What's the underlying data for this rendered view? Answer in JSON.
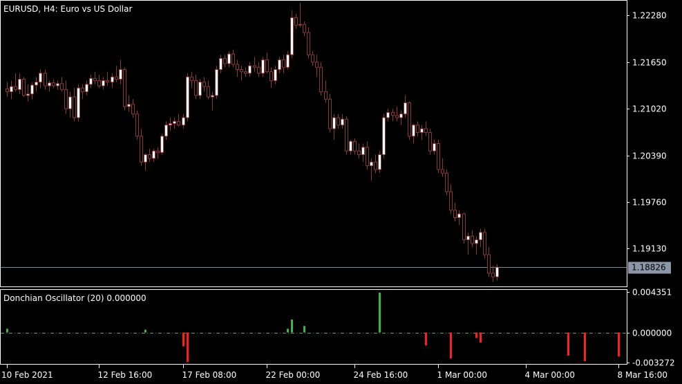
{
  "chart_title": "EURUSD, H4:  Euro vs US Dollar",
  "indicator_title": "Donchian Oscillator (20) 0.000000",
  "current_price": "1.18826",
  "colors": {
    "background": "#000000",
    "axis": "#ffffff",
    "bull_fill": "#ffffff",
    "bear_fill": "#000000",
    "candle_outline": "#8b3a3a",
    "osc_up": "#3cb93c",
    "osc_down": "#ff1e1e",
    "price_line": "#7f8a9a",
    "price_tag_bg": "#8b97a6",
    "zero_line": "#6a8f6a"
  },
  "chart_data": {
    "type": "candlestick",
    "instrument": "EURUSD",
    "timeframe": "H4",
    "price_axis": {
      "ticks": [
        "1.22280",
        "1.21650",
        "1.21020",
        "1.20390",
        "1.19760",
        "1.19130"
      ],
      "tick_values": [
        1.2228,
        1.2165,
        1.2102,
        1.2039,
        1.1976,
        1.1913
      ],
      "range": [
        1.1862,
        1.2248
      ]
    },
    "time_axis": {
      "labels": [
        "10 Feb 2021",
        "12 Feb 16:00",
        "17 Feb 08:00",
        "22 Feb 00:00",
        "24 Feb 16:00",
        "1 Mar 00:00",
        "4 Mar 00:00",
        "8 Mar 16:00"
      ],
      "label_bars": [
        0,
        22,
        42,
        62,
        83,
        103,
        124,
        146
      ]
    },
    "candles": [
      [
        1.2129,
        1.2138,
        1.2118,
        1.2125
      ],
      [
        1.2125,
        1.214,
        1.2115,
        1.2132
      ],
      [
        1.2132,
        1.215,
        1.2125,
        1.2128
      ],
      [
        1.2128,
        1.215,
        1.2122,
        1.2142
      ],
      [
        1.2142,
        1.2145,
        1.2118,
        1.212
      ],
      [
        1.212,
        1.2135,
        1.2112,
        1.2122
      ],
      [
        1.2122,
        1.2138,
        1.2115,
        1.2134
      ],
      [
        1.2134,
        1.2145,
        1.2125,
        1.2138
      ],
      [
        1.2138,
        1.2155,
        1.213,
        1.215
      ],
      [
        1.215,
        1.2155,
        1.2128,
        1.2133
      ],
      [
        1.2133,
        1.214,
        1.2125,
        1.2137
      ],
      [
        1.2137,
        1.2142,
        1.213,
        1.2133
      ],
      [
        1.2133,
        1.214,
        1.2128,
        1.2136
      ],
      [
        1.2136,
        1.2145,
        1.2125,
        1.2128
      ],
      [
        1.2128,
        1.214,
        1.2095,
        1.2102
      ],
      [
        1.2102,
        1.2125,
        1.209,
        1.2118
      ],
      [
        1.2118,
        1.213,
        1.2085,
        1.209
      ],
      [
        1.209,
        1.2135,
        1.2085,
        1.213
      ],
      [
        1.213,
        1.2135,
        1.2115,
        1.2125
      ],
      [
        1.2125,
        1.214,
        1.212,
        1.2135
      ],
      [
        1.2135,
        1.2148,
        1.213,
        1.2143
      ],
      [
        1.2143,
        1.2152,
        1.2135,
        1.214
      ],
      [
        1.214,
        1.2148,
        1.213,
        1.2133
      ],
      [
        1.2133,
        1.2145,
        1.2128,
        1.214
      ],
      [
        1.214,
        1.2152,
        1.2133,
        1.2138
      ],
      [
        1.2138,
        1.215,
        1.213,
        1.2145
      ],
      [
        1.2145,
        1.216,
        1.2138,
        1.2142
      ],
      [
        1.2142,
        1.2168,
        1.2135,
        1.2155
      ],
      [
        1.2155,
        1.2158,
        1.21,
        1.2105
      ],
      [
        1.2105,
        1.212,
        1.2098,
        1.2108
      ],
      [
        1.2108,
        1.2115,
        1.209,
        1.2095
      ],
      [
        1.2095,
        1.21,
        1.206,
        1.2065
      ],
      [
        1.2065,
        1.2075,
        1.2025,
        1.203
      ],
      [
        1.203,
        1.2042,
        1.2018,
        1.204
      ],
      [
        1.204,
        1.2048,
        1.203,
        1.2035
      ],
      [
        1.2035,
        1.2048,
        1.203,
        1.2045
      ],
      [
        1.2045,
        1.205,
        1.2035,
        1.2043
      ],
      [
        1.2043,
        1.2068,
        1.204,
        1.2065
      ],
      [
        1.2065,
        1.2085,
        1.206,
        1.208
      ],
      [
        1.208,
        1.209,
        1.2072,
        1.2082
      ],
      [
        1.2082,
        1.209,
        1.2075,
        1.2085
      ],
      [
        1.2085,
        1.2095,
        1.2078,
        1.208
      ],
      [
        1.208,
        1.2095,
        1.2075,
        1.209
      ],
      [
        1.209,
        1.215,
        1.2085,
        1.2145
      ],
      [
        1.2145,
        1.2152,
        1.213,
        1.214
      ],
      [
        1.214,
        1.2148,
        1.2115,
        1.212
      ],
      [
        1.212,
        1.2142,
        1.2115,
        1.2138
      ],
      [
        1.2138,
        1.2145,
        1.2125,
        1.2132
      ],
      [
        1.2132,
        1.214,
        1.2115,
        1.2118
      ],
      [
        1.2118,
        1.2125,
        1.21,
        1.212
      ],
      [
        1.212,
        1.216,
        1.2115,
        1.2155
      ],
      [
        1.2155,
        1.2175,
        1.215,
        1.217
      ],
      [
        1.217,
        1.2175,
        1.2158,
        1.2163
      ],
      [
        1.2163,
        1.218,
        1.2158,
        1.2176
      ],
      [
        1.2176,
        1.2182,
        1.2158,
        1.2162
      ],
      [
        1.2162,
        1.2168,
        1.2145,
        1.2155
      ],
      [
        1.2155,
        1.216,
        1.214,
        1.2152
      ],
      [
        1.2152,
        1.2158,
        1.2145,
        1.215
      ],
      [
        1.215,
        1.2165,
        1.2145,
        1.216
      ],
      [
        1.216,
        1.2172,
        1.2152,
        1.2158
      ],
      [
        1.2158,
        1.2165,
        1.2145,
        1.215
      ],
      [
        1.215,
        1.2172,
        1.2145,
        1.2168
      ],
      [
        1.2168,
        1.2178,
        1.215,
        1.2152
      ],
      [
        1.2152,
        1.2158,
        1.213,
        1.214
      ],
      [
        1.214,
        1.216,
        1.2135,
        1.2155
      ],
      [
        1.2155,
        1.2172,
        1.215,
        1.2168
      ],
      [
        1.2168,
        1.2175,
        1.215,
        1.2158
      ],
      [
        1.2158,
        1.218,
        1.2155,
        1.2175
      ],
      [
        1.2175,
        1.2235,
        1.217,
        1.2225
      ],
      [
        1.2225,
        1.223,
        1.221,
        1.2215
      ],
      [
        1.2215,
        1.2245,
        1.2212,
        1.2216
      ],
      [
        1.2216,
        1.222,
        1.22,
        1.2205
      ],
      [
        1.2205,
        1.2212,
        1.217,
        1.2175
      ],
      [
        1.2175,
        1.218,
        1.216,
        1.2165
      ],
      [
        1.2165,
        1.2175,
        1.2145,
        1.2158
      ],
      [
        1.2158,
        1.2165,
        1.212,
        1.2125
      ],
      [
        1.2125,
        1.214,
        1.211,
        1.2115
      ],
      [
        1.2115,
        1.2122,
        1.207,
        1.2075
      ],
      [
        1.2075,
        1.2095,
        1.206,
        1.209
      ],
      [
        1.209,
        1.2095,
        1.2075,
        1.208
      ],
      [
        1.208,
        1.2095,
        1.2075,
        1.2088
      ],
      [
        1.2088,
        1.2092,
        1.204,
        1.2045
      ],
      [
        1.2045,
        1.206,
        1.204,
        1.2058
      ],
      [
        1.2058,
        1.2062,
        1.204,
        1.2045
      ],
      [
        1.2045,
        1.2055,
        1.2035,
        1.204
      ],
      [
        1.204,
        1.2055,
        1.203,
        1.205
      ],
      [
        1.205,
        1.2058,
        1.202,
        1.2025
      ],
      [
        1.2025,
        1.2035,
        1.2005,
        1.203
      ],
      [
        1.203,
        1.204,
        1.2015,
        1.202
      ],
      [
        1.202,
        1.2045,
        1.2015,
        1.204
      ],
      [
        1.204,
        1.2095,
        1.2035,
        1.209
      ],
      [
        1.209,
        1.2102,
        1.2085,
        1.2097
      ],
      [
        1.2097,
        1.2102,
        1.2085,
        1.2093
      ],
      [
        1.2093,
        1.2105,
        1.2085,
        1.209
      ],
      [
        1.209,
        1.21,
        1.208,
        1.2095
      ],
      [
        1.2095,
        1.212,
        1.209,
        1.211
      ],
      [
        1.211,
        1.2112,
        1.206,
        1.2065
      ],
      [
        1.2065,
        1.2082,
        1.2055,
        1.208
      ],
      [
        1.208,
        1.2085,
        1.2065,
        1.207
      ],
      [
        1.207,
        1.208,
        1.206,
        1.2075
      ],
      [
        1.2075,
        1.2085,
        1.2065,
        1.207
      ],
      [
        1.207,
        1.2075,
        1.204,
        1.2045
      ],
      [
        1.2045,
        1.206,
        1.204,
        1.2055
      ],
      [
        1.2055,
        1.206,
        1.2015,
        1.202
      ],
      [
        1.202,
        1.2035,
        1.201,
        1.2015
      ],
      [
        1.2015,
        1.202,
        1.1985,
        1.199
      ],
      [
        1.199,
        1.2,
        1.196,
        1.1965
      ],
      [
        1.1965,
        1.1975,
        1.195,
        1.1955
      ],
      [
        1.1955,
        1.1965,
        1.1945,
        1.196
      ],
      [
        1.196,
        1.1962,
        1.192,
        1.1925
      ],
      [
        1.1925,
        1.1935,
        1.1905,
        1.193
      ],
      [
        1.193,
        1.1938,
        1.1915,
        1.192
      ],
      [
        1.192,
        1.193,
        1.1905,
        1.1925
      ],
      [
        1.1925,
        1.194,
        1.1915,
        1.1935
      ],
      [
        1.1935,
        1.194,
        1.19,
        1.1905
      ],
      [
        1.1905,
        1.1915,
        1.1875,
        1.188
      ],
      [
        1.188,
        1.189,
        1.1868,
        1.1875
      ],
      [
        1.1875,
        1.1892,
        1.187,
        1.1888
      ]
    ],
    "oscillator": {
      "name": "Donchian Oscillator (20)",
      "value": "0.000000",
      "axis_ticks": [
        "0.004351",
        "0.000000",
        "-0.003272"
      ],
      "axis_values": [
        0.004351,
        0.0,
        -0.003272
      ],
      "range": [
        -0.0034,
        0.0046
      ],
      "bars": [
        [
          0,
          0.0004
        ],
        [
          33,
          0.0003
        ],
        [
          42,
          -0.0015
        ],
        [
          43,
          -0.0032
        ],
        [
          67,
          0.0004
        ],
        [
          68,
          0.0014
        ],
        [
          71,
          0.0007
        ],
        [
          89,
          0.0043
        ],
        [
          100,
          -0.0014
        ],
        [
          106,
          -0.0028
        ],
        [
          112,
          -0.0006
        ],
        [
          113,
          -0.0011
        ],
        [
          134,
          -0.0025
        ],
        [
          138,
          -0.0031
        ],
        [
          146,
          -0.0026
        ]
      ]
    }
  }
}
